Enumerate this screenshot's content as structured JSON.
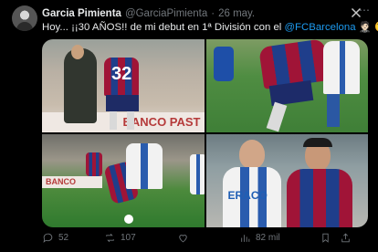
{
  "user": {
    "name": "Garcia Pimienta",
    "handle": "@GarciaPimienta",
    "date": "26 may.",
    "separator": "·"
  },
  "post": {
    "text_before": "Hoy... ¡¡30 AÑOS!! de mi debut en 1ª División con el ",
    "mention": "@FCBarcelona",
    "text_after": " 🤵🏻 😉"
  },
  "media": {
    "photo1": {
      "jersey_number": "32",
      "banner_text": "BANCO PAST"
    },
    "photo3": {
      "banner_text": "BANCO"
    },
    "photo4": {
      "shirt_text": "ERACO"
    }
  },
  "actions": {
    "replies": "52",
    "reposts": "107",
    "likes": "",
    "views": "82 mil"
  },
  "icons": [
    "x-logo-icon",
    "more-icon",
    "reply-icon",
    "repost-icon",
    "like-icon",
    "views-icon",
    "bookmark-icon",
    "share-icon"
  ],
  "colors": {
    "link": "#1d9bf0",
    "muted": "#71767b",
    "text": "#e7e9ea",
    "background": "#000000"
  }
}
